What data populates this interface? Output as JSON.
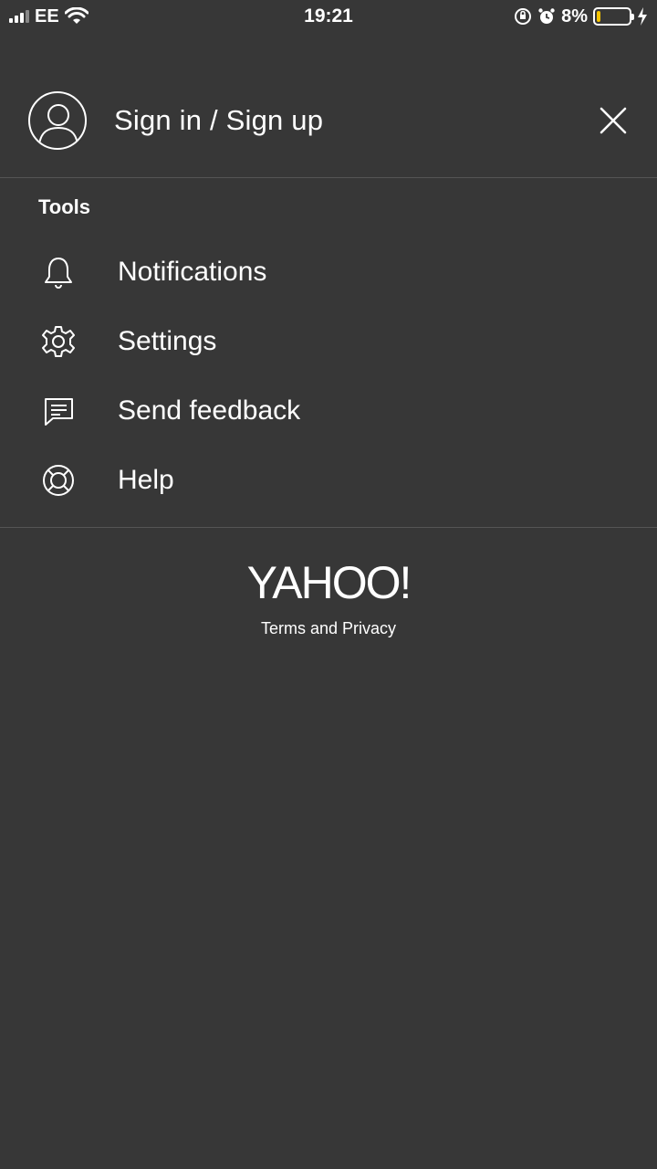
{
  "status_bar": {
    "carrier": "EE",
    "time": "19:21",
    "battery_percent": "8%",
    "battery_level": 0.08,
    "battery_color": "#f5c400"
  },
  "drawer": {
    "signin_label": "Sign in / Sign up",
    "section_title": "Tools",
    "items": [
      {
        "label": "Notifications",
        "icon": "bell-icon"
      },
      {
        "label": "Settings",
        "icon": "gear-icon"
      },
      {
        "label": "Send feedback",
        "icon": "feedback-icon"
      },
      {
        "label": "Help",
        "icon": "lifebuoy-icon"
      }
    ]
  },
  "footer": {
    "logo": "YAHOO!",
    "terms_label": "Terms and Privacy"
  },
  "colors": {
    "background": "#373737",
    "divider": "#555555",
    "text": "#ffffff"
  }
}
